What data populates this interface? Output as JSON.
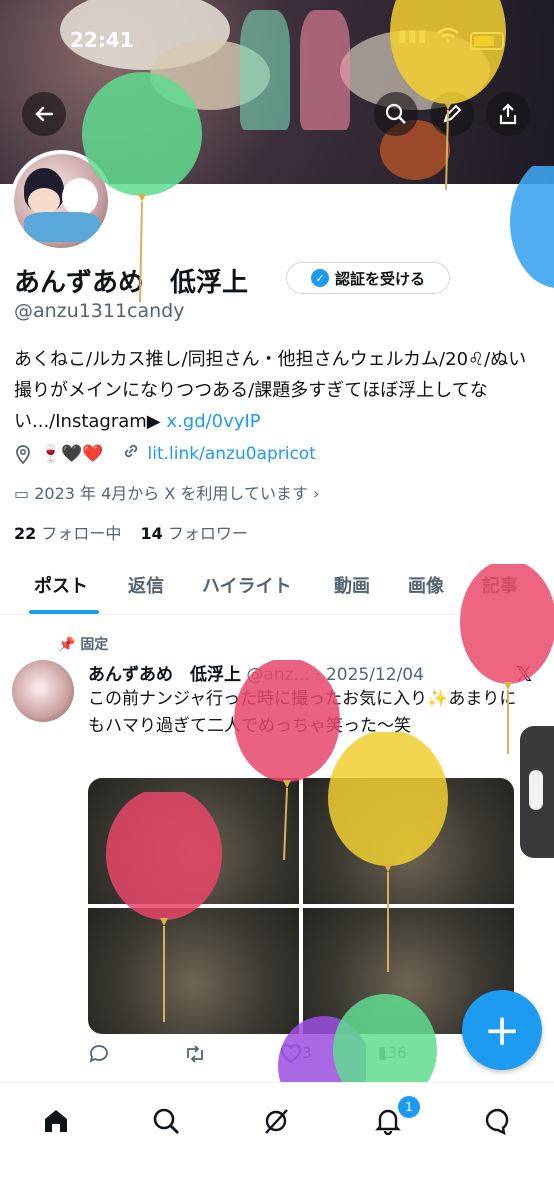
{
  "status_bar": {
    "time": "22:41"
  },
  "profile": {
    "name": "あんずあめ　低浮上",
    "handle": "@anzu1311candy",
    "verify_button": "認証を受ける",
    "bio_text": "あくねこ/ルカス推し/同担さん・他担さんウェルカム/20♌/ぬい撮りがメインになりつつある/課題多すぎてほぼ浮上してない.../Instagram▶",
    "bio_link": "x.gd/0vyIP",
    "location_emoji": "🍷🖤❤️",
    "website": "lit.link/anzu0apricot",
    "joined": "2023 年 4月から X を利用しています",
    "following_count": "22",
    "following_label": "フォロー中",
    "followers_count": "14",
    "followers_label": "フォロワー"
  },
  "tabs": [
    "ポスト",
    "返信",
    "ハイライト",
    "動画",
    "画像",
    "記事"
  ],
  "pinned_post": {
    "pinned_label": "固定",
    "author": "あんずあめ　低浮上",
    "handle_date": "@anz... · 2025/12/04",
    "text": "この前ナンジャ行った時に撮ったお気に入り✨あまりにもハマり過ぎて二人でめっちゃ笑った〜笑",
    "likes": "3",
    "views": "136"
  },
  "nav": {
    "notification_count": "1"
  },
  "icons": [
    "back-arrow-icon",
    "search-icon",
    "edit-icon",
    "share-icon",
    "verified-badge-icon",
    "location-icon",
    "link-icon",
    "calendar-icon",
    "pin-icon",
    "x-logo-icon",
    "reply-icon",
    "retweet-icon",
    "heart-icon",
    "views-icon",
    "home-icon",
    "search-nav-icon",
    "grok-icon",
    "bell-icon",
    "messages-icon",
    "plus-icon"
  ]
}
